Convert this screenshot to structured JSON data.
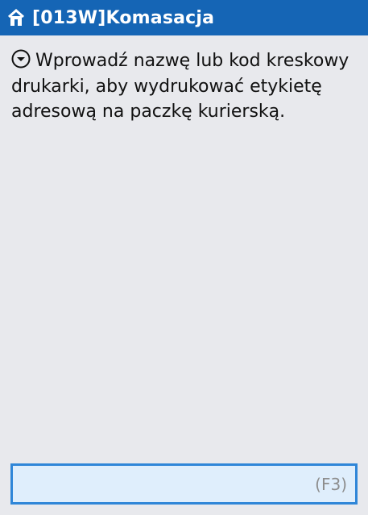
{
  "header": {
    "title": "[013W]Komasacja",
    "back_icon": "back-arrow-icon"
  },
  "message": {
    "icon": "chevron-down-circle-icon",
    "text": "Wprowadź nazwę lub kod kreskowy drukarki, aby wydrukować etykietę adresową na paczkę kurierską."
  },
  "input": {
    "value": "",
    "placeholder": "",
    "hotkey": "(F3)"
  },
  "colors": {
    "header_bg": "#1565b5",
    "page_bg": "#e8e9ed",
    "input_bg": "#dfeefc",
    "input_border": "#2f86d8"
  }
}
